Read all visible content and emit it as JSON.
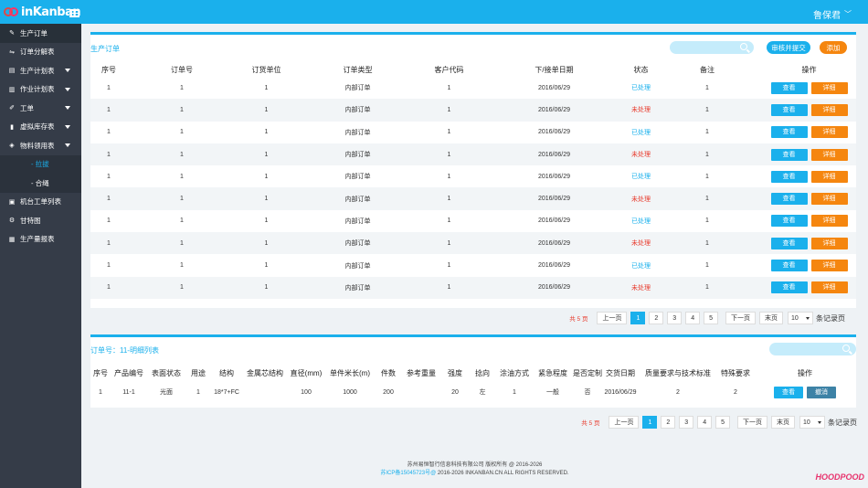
{
  "app": {
    "logo_text": "inKanban",
    "user_name": "鲁保君"
  },
  "sidebar": {
    "items": [
      {
        "label": "生产订单",
        "icon": "edit-icon",
        "glyph": "✎",
        "arrow": false,
        "active": true
      },
      {
        "label": "订单分解表",
        "icon": "split-icon",
        "glyph": "⇋",
        "arrow": false,
        "active": false
      },
      {
        "label": "生产计划表",
        "icon": "document-icon",
        "glyph": "▤",
        "arrow": true,
        "active": false
      },
      {
        "label": "作业计划表",
        "icon": "clipboard-icon",
        "glyph": "▥",
        "arrow": true,
        "active": false
      },
      {
        "label": "工单",
        "icon": "pencil-icon",
        "glyph": "✐",
        "arrow": true,
        "active": false
      },
      {
        "label": "虚拟库存表",
        "icon": "bar-chart-icon",
        "glyph": "▮",
        "arrow": true,
        "active": false
      },
      {
        "label": "物料领用表",
        "icon": "shield-icon",
        "glyph": "◈",
        "arrow": true,
        "active": false
      }
    ],
    "sub_items": [
      {
        "label": "- 拉拔",
        "active": true
      },
      {
        "label": "- 合绳",
        "active": false
      }
    ],
    "items_after": [
      {
        "label": "机台工单列表",
        "icon": "inbox-icon",
        "glyph": "▣",
        "arrow": false
      },
      {
        "label": "甘特图",
        "icon": "gear-icon",
        "glyph": "⚙",
        "arrow": false
      },
      {
        "label": "生产量报表",
        "icon": "report-icon",
        "glyph": "▦",
        "arrow": false
      }
    ]
  },
  "orders": {
    "title": "生产订单",
    "search_placeholder": "",
    "approve_label": "审核并提交",
    "add_label": "添加",
    "columns": [
      "序号",
      "订单号",
      "订货单位",
      "订单类型",
      "客户代码",
      "下/接单日期",
      "状态",
      "备注",
      "操作"
    ],
    "rows": [
      [
        "1",
        "1",
        "1",
        "内部订单",
        "1",
        "2016/06/29",
        "已处理",
        "1"
      ],
      [
        "1",
        "1",
        "1",
        "内部订单",
        "1",
        "2016/06/29",
        "未处理",
        "1"
      ],
      [
        "1",
        "1",
        "1",
        "内部订单",
        "1",
        "2016/06/29",
        "已处理",
        "1"
      ],
      [
        "1",
        "1",
        "1",
        "内部订单",
        "1",
        "2016/06/29",
        "未处理",
        "1"
      ],
      [
        "1",
        "1",
        "1",
        "内部订单",
        "1",
        "2016/06/29",
        "已处理",
        "1"
      ],
      [
        "1",
        "1",
        "1",
        "内部订单",
        "1",
        "2016/06/29",
        "未处理",
        "1"
      ],
      [
        "1",
        "1",
        "1",
        "内部订单",
        "1",
        "2016/06/29",
        "已处理",
        "1"
      ],
      [
        "1",
        "1",
        "1",
        "内部订单",
        "1",
        "2016/06/29",
        "未处理",
        "1"
      ],
      [
        "1",
        "1",
        "1",
        "内部订单",
        "1",
        "2016/06/29",
        "已处理",
        "1"
      ],
      [
        "1",
        "1",
        "1",
        "内部订单",
        "1",
        "2016/06/29",
        "未处理",
        "1"
      ]
    ],
    "view_label": "查看",
    "detail_label": "详细"
  },
  "pager": {
    "total": "共 5 页",
    "prev": "上一页",
    "pages": [
      "1",
      "2",
      "3",
      "4",
      "5"
    ],
    "current": "1",
    "next": "下一页",
    "last": "末页",
    "per_page": "10",
    "per_label": "条记录页"
  },
  "detail": {
    "title": "订单号：11-明细列表",
    "columns": [
      "序号",
      "产品编号",
      "表面状态",
      "用途",
      "结构",
      "金属芯结构",
      "直径(mm)",
      "单件米长(m)",
      "件数",
      "参考重量",
      "强度",
      "捻向",
      "涂油方式",
      "紧急程度",
      "是否定制",
      "交货日期",
      "质量要求与技术标准",
      "特殊要求",
      "操作"
    ],
    "rows": [
      [
        "1",
        "11-1",
        "光面",
        "1",
        "18*7+FC",
        "",
        "100",
        "1000",
        "200",
        "",
        "20",
        "左",
        "1",
        "一般",
        "否",
        "2016/06/29",
        "2",
        "2"
      ]
    ],
    "view_label": "查看",
    "cancel_label": "撤消"
  },
  "footer": {
    "line1": "苏州易恒智行信息科技有限公司 版权所有 @ 2016-2026",
    "icp_link": "苏ICP备15045723号@",
    "line2_rest": " 2016-2026 INKANBAN.CN ALL RIGHTS RESERVED."
  },
  "brand": "HOODPOOD",
  "colors": {
    "accent": "#1ab0ec",
    "orange": "#f5860f",
    "sidebar": "#353c48",
    "danger": "#e83b2d"
  }
}
